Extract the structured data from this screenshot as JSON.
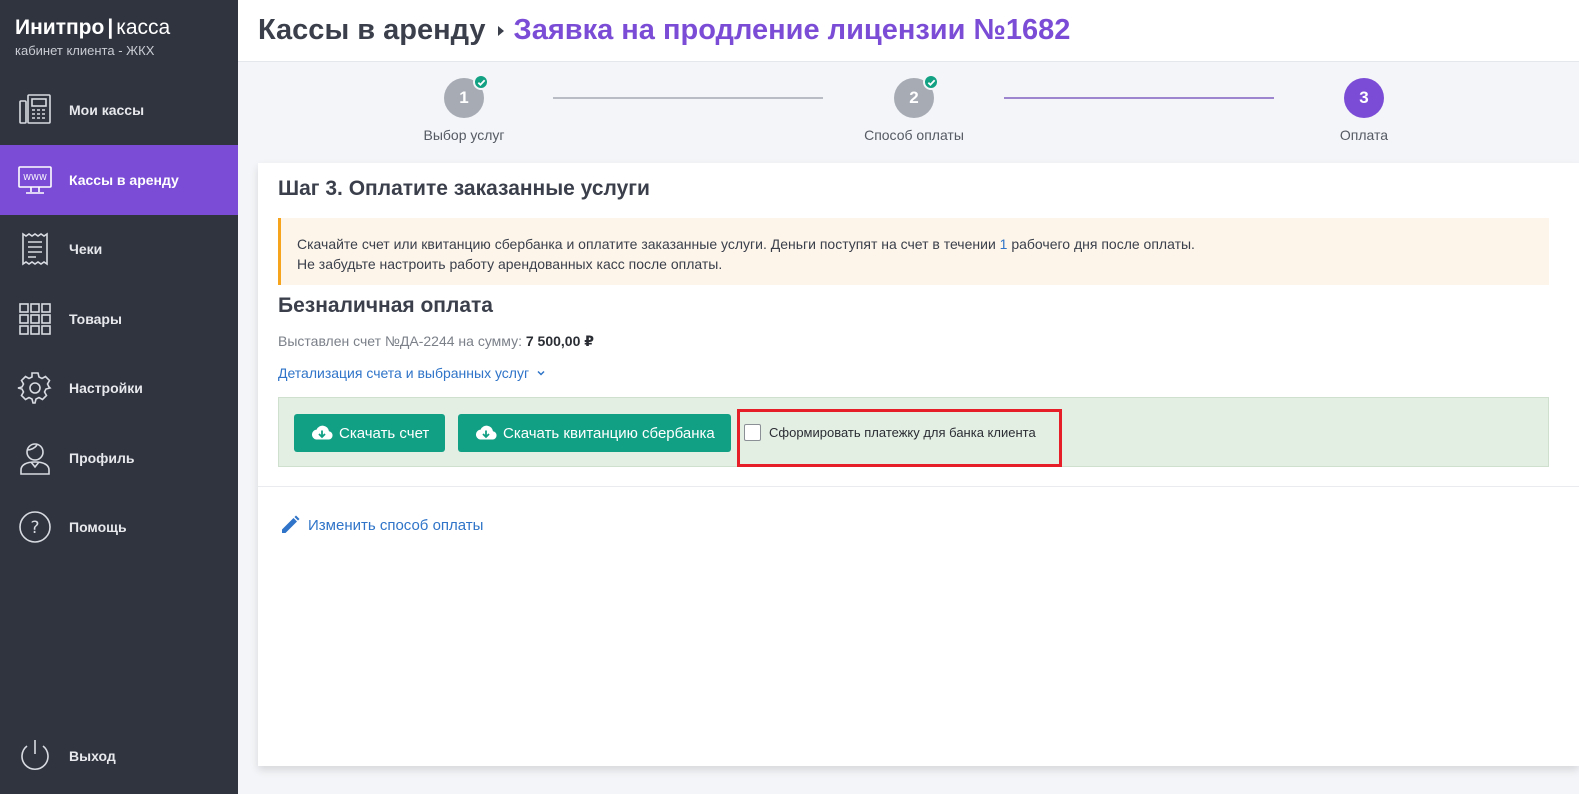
{
  "brand": {
    "name": "Инитпро",
    "separator": "|",
    "product": "касса",
    "subtitle": "кабинет клиента - ЖКХ"
  },
  "sidebar": {
    "items": [
      {
        "label": "Мои кассы",
        "icon": "cash-register-icon"
      },
      {
        "label": "Кассы в аренду",
        "icon": "monitor-www-icon",
        "active": true
      },
      {
        "label": "Чеки",
        "icon": "receipt-icon"
      },
      {
        "label": "Товары",
        "icon": "grid-icon"
      },
      {
        "label": "Настройки",
        "icon": "gear-icon"
      },
      {
        "label": "Профиль",
        "icon": "user-icon"
      },
      {
        "label": "Помощь",
        "icon": "help-icon"
      }
    ],
    "logout": {
      "label": "Выход",
      "icon": "power-icon"
    }
  },
  "header": {
    "breadcrumb_root": "Кассы в аренду",
    "breadcrumb_current": "Заявка на продление лицензии №1682"
  },
  "stepper": {
    "steps": [
      {
        "number": "1",
        "label": "Выбор услуг",
        "status": "done"
      },
      {
        "number": "2",
        "label": "Способ оплаты",
        "status": "done"
      },
      {
        "number": "3",
        "label": "Оплата",
        "status": "current"
      }
    ]
  },
  "main": {
    "step_title": "Шаг 3. Оплатите заказанные услуги",
    "notice": {
      "line1_before": "Скачайте счет или квитанцию сбербанка и оплатите заказанные услуги. Деньги поступят на счет в течении ",
      "line1_highlight": "1",
      "line1_after": " рабочего дня после оплаты.",
      "line2": "Не забудьте настроить работу арендованных касс после оплаты."
    },
    "section_title": "Безналичная оплата",
    "invoice_text": "Выставлен счет №ДА-2244 на сумму: ",
    "invoice_amount": "7 500,00 ₽",
    "details_link": "Детализация счета и выбранных услуг",
    "buttons": {
      "download_invoice": "Скачать счет",
      "download_sberbank": "Скачать квитанцию сбербанка"
    },
    "checkbox_label": "Сформировать платежку для банка клиента",
    "change_payment_link": "Изменить способ оплаты"
  },
  "colors": {
    "accent": "#7b4dd6",
    "sidebar": "#30343f",
    "button": "#12a085",
    "link": "#2f74c8",
    "highlight_border": "#e61e27"
  }
}
